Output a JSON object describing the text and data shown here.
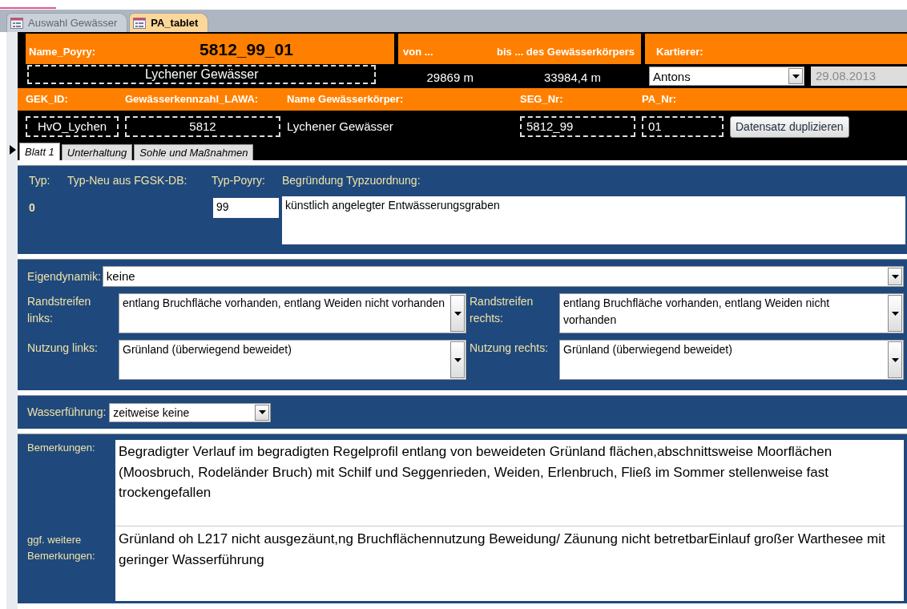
{
  "document_tabs": [
    {
      "label": "Auswahl Gewässer",
      "selected": false
    },
    {
      "label": "PA_tablet",
      "selected": true
    }
  ],
  "header": {
    "name_label": "Name_Poyry:",
    "name_value": "5812_99_01",
    "gewaesser_name": "Lychener Gewässer",
    "von_label": "von ...",
    "bis_label": "bis ... des Gewässerkörpers",
    "von_value": "29869 m",
    "bis_value": "33984,4 m",
    "kartierer_label": "Kartierer:",
    "kartierer_value": "Antons",
    "date": {
      "value": "29.08.2013",
      "disabled": true
    },
    "fields": [
      {
        "label": "GEK_ID:",
        "value": "HvO_Lychen",
        "kind": "centered"
      },
      {
        "label": "Gewässerkennzahl_LAWA:",
        "value": "5812",
        "kind": "centered"
      },
      {
        "label": "Name Gewässerkörper:",
        "value": "Lychener Gewässer",
        "kind": "plain"
      },
      {
        "label": "SEG_Nr:",
        "value": "5812_99",
        "kind": "boxed"
      },
      {
        "label": "PA_Nr:",
        "value": "01",
        "kind": "boxed"
      }
    ],
    "duplicate_button": "Datensatz duplizieren"
  },
  "form_tabs": [
    {
      "label": "Blatt 1",
      "selected": true
    },
    {
      "label": "Unterhaltung",
      "selected": false
    },
    {
      "label": "Sohle und Maßnahmen",
      "selected": false
    }
  ],
  "typ_section": {
    "typ_label": "Typ:",
    "typ_neu_label": "Typ-Neu aus FGSK-DB:",
    "typ_poyry_label": "Typ-Poyry:",
    "begruendung_label": "Begründung Typzuordnung:",
    "typ_value": "0",
    "typ_poyry_value": "99",
    "begruendung_value": "künstlich angelegter Entwässerungsgraben"
  },
  "eigendynamik": {
    "label": "Eigendynamik:",
    "value": "keine"
  },
  "dropdowns": [
    {
      "label": "Randstreifen links:",
      "value": "entlang Bruchfläche vorhanden, entlang Weiden nicht vorhanden"
    },
    {
      "label": "Randstreifen rechts:",
      "value": "entlang Bruchfläche vorhanden, entlang Weiden nicht vorhanden"
    },
    {
      "label": "Nutzung links:",
      "value": "Grünland (überwiegend beweidet)"
    },
    {
      "label": "Nutzung rechts:",
      "value": "Grünland (überwiegend beweidet)"
    }
  ],
  "wasserfuehrung": {
    "label": "Wasserführung:",
    "value": "zeitweise keine"
  },
  "remarks": [
    {
      "label": "Bemerkungen:",
      "value": "Begradigter Verlauf im begradigten Regelprofil  entlang von beweideten Grünland flächen,abschnittsweise Moorflächen (Moosbruch, Rodeländer Bruch) mit Schilf und Seggenrieden, Weiden, Erlenbruch, Fließ im Sommer stellenweise fast trockengefallen"
    },
    {
      "label": "ggf. weitere Bemerkungen:",
      "value": "Grünland oh L217 nicht ausgezäunt,ng Bruchflächennutzung Beweidung/ Zäunung nicht betretbarEinlauf großer Warthesee  mit geringer Wasserführung"
    }
  ]
}
